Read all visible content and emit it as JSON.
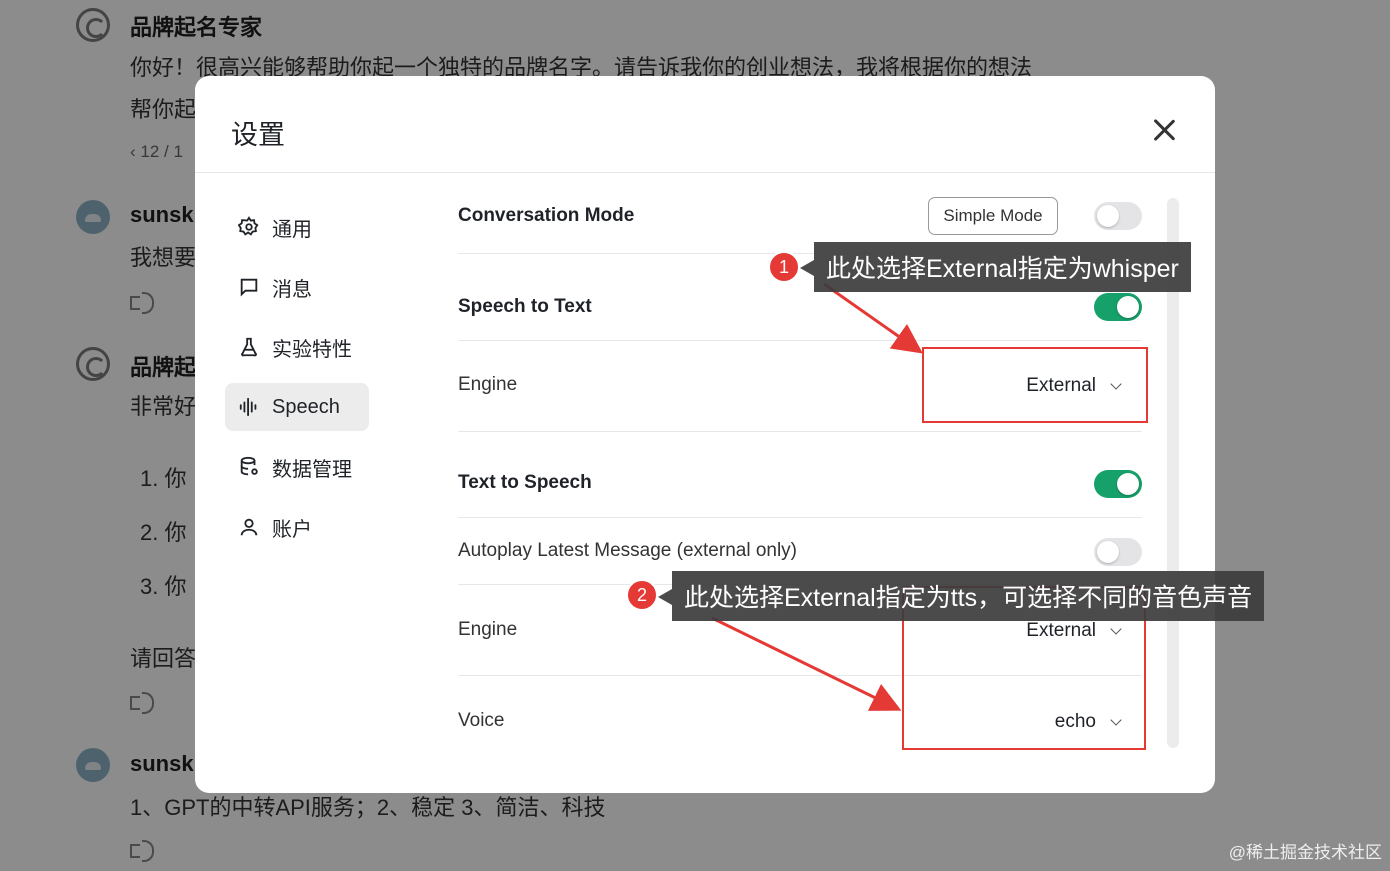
{
  "background_chat": {
    "messages": [
      {
        "role": "bot",
        "name": "品牌起名专家",
        "lines": [
          "你好！很高兴能够帮助你起一个独特的品牌名字。请告诉我你的创业想法，我将根据你的想法",
          "帮你起"
        ],
        "pager": "‹  12 / 1"
      },
      {
        "role": "user",
        "name": "sunsk",
        "lines": [
          "我想要"
        ]
      },
      {
        "role": "bot",
        "name": "品牌起",
        "lines": [
          "非常好",
          "1.  你",
          "2.  你",
          "3.  你",
          "请回答"
        ]
      },
      {
        "role": "user",
        "name": "sunsk",
        "lines": [
          "1、GPT的中转API服务；2、稳定 3、简洁、科技"
        ]
      }
    ],
    "watermark": "@稀土掘金技术社区"
  },
  "modal": {
    "title": "设置",
    "nav": [
      {
        "label": "通用",
        "icon": "gear-icon"
      },
      {
        "label": "消息",
        "icon": "message-icon"
      },
      {
        "label": "实验特性",
        "icon": "flask-icon"
      },
      {
        "label": "Speech",
        "icon": "waveform-icon",
        "active": true
      },
      {
        "label": "数据管理",
        "icon": "database-icon"
      },
      {
        "label": "账户",
        "icon": "user-icon"
      }
    ],
    "speech": {
      "conversation_mode": {
        "label": "Conversation Mode",
        "button": "Simple Mode",
        "enabled": false
      },
      "stt": {
        "label": "Speech to Text",
        "enabled": true,
        "engine_label": "Engine",
        "engine_value": "External"
      },
      "tts": {
        "label": "Text to Speech",
        "enabled": true,
        "autoplay_label": "Autoplay Latest Message (external only)",
        "autoplay_enabled": false,
        "engine_label": "Engine",
        "engine_value": "External",
        "voice_label": "Voice",
        "voice_value": "echo"
      }
    }
  },
  "annotations": [
    {
      "number": "1",
      "text": "此处选择External指定为whisper"
    },
    {
      "number": "2",
      "text": "此处选择External指定为tts，可选择不同的音色声音"
    }
  ],
  "colors": {
    "toggle_on": "#16a06a",
    "annotation_red": "#e53935"
  }
}
